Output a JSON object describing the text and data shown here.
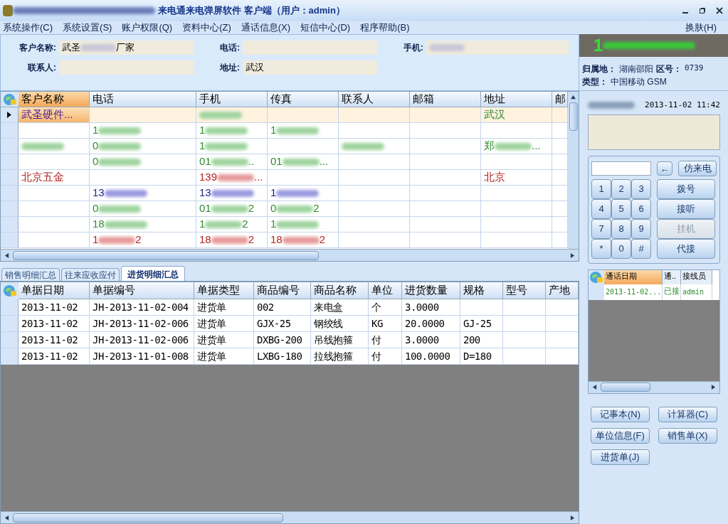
{
  "window": {
    "title": "来电通来电弹屏软件 客户端（用户：admin）"
  },
  "menu": [
    "系统操作(C)",
    "系统设置(S)",
    "账户权限(Q)",
    "资料中心(Z)",
    "通话信息(X)",
    "短信中心(D)",
    "程序帮助(B)"
  ],
  "skin_menu": "换肤(H)",
  "customer_form": [
    {
      "label": "客户名称:",
      "value": "武圣",
      "tail": "厂家",
      "blur": true
    },
    {
      "label": "电话:"
    },
    {
      "label": "手机:",
      "blur": true
    },
    {
      "label": "联系人:"
    },
    {
      "label": "地址:",
      "value": "武汉"
    }
  ],
  "customer_grid": {
    "columns": [
      "客户名称",
      "电话",
      "手机",
      "传真",
      "联系人",
      "邮箱",
      "地址",
      "邮"
    ],
    "rows": [
      {
        "selected": true,
        "color": "#4b1a8a",
        "cells": [
          {
            "text": "武圣硬件..."
          },
          null,
          {
            "blur": true
          },
          null,
          null,
          null,
          {
            "text": "武汉",
            "color": "#2e8b2e"
          },
          null
        ]
      },
      {
        "selected": false,
        "color": "#2e8b2e",
        "cells": [
          null,
          {
            "text": "1",
            "blur": true
          },
          {
            "text": "1",
            "blur": true
          },
          {
            "text": "1",
            "blur": true
          },
          null,
          null,
          null,
          null
        ]
      },
      {
        "selected": false,
        "color": "#2e8b2e",
        "cells": [
          {
            "blur": true
          },
          {
            "text": "0",
            "blur": true
          },
          {
            "text": "1",
            "blur": true
          },
          null,
          {
            "blur": true
          },
          null,
          {
            "text": "郑",
            "blur": true,
            "tail": "..."
          },
          null
        ]
      },
      {
        "selected": false,
        "color": "#2e8b2e",
        "cells": [
          null,
          {
            "text": "0",
            "blur": true
          },
          {
            "text": "01",
            "blur": true,
            "tail": ".."
          },
          {
            "text": "01",
            "blur": true,
            "tail": "..."
          },
          null,
          null,
          null,
          null
        ]
      },
      {
        "selected": false,
        "color": "#b22222",
        "cells": [
          {
            "text": "北京五金"
          },
          null,
          {
            "text": "139",
            "blur": true,
            "tail": "..."
          },
          null,
          null,
          null,
          {
            "text": "北京"
          },
          null
        ]
      },
      {
        "selected": false,
        "color": "#22228b",
        "cells": [
          null,
          {
            "text": "13",
            "blur": true
          },
          {
            "text": "13",
            "blur": true
          },
          {
            "text": "1",
            "blur": true
          },
          null,
          null,
          null,
          null
        ]
      },
      {
        "selected": false,
        "color": "#2e8b2e",
        "cells": [
          null,
          {
            "text": "0",
            "blur": true
          },
          {
            "text": "01",
            "blur": true,
            "tail": "2"
          },
          {
            "text": "0",
            "blur": true,
            "tail": "2"
          },
          null,
          null,
          null,
          null
        ]
      },
      {
        "selected": false,
        "color": "#2e8b2e",
        "cells": [
          null,
          {
            "text": "18",
            "blur": true
          },
          {
            "text": "1",
            "blur": true,
            "tail": "2"
          },
          {
            "text": "1",
            "blur": true
          },
          null,
          null,
          null,
          null
        ]
      },
      {
        "selected": false,
        "color": "#b22222",
        "cells": [
          null,
          {
            "text": "1",
            "blur": true,
            "tail": "2"
          },
          {
            "text": "18",
            "blur": true,
            "tail": "2"
          },
          {
            "text": "18",
            "blur": true,
            "tail": "2"
          },
          null,
          null,
          null,
          null
        ]
      }
    ]
  },
  "detail_tabs": [
    {
      "label": "销售明细汇总",
      "selected": false
    },
    {
      "label": "往来应收应付",
      "selected": false
    },
    {
      "label": "进货明细汇总",
      "selected": true
    }
  ],
  "detail_grid": {
    "columns": [
      "单据日期",
      "单据编号",
      "单据类型",
      "商品编号",
      "商品名称",
      "单位",
      "进货数量",
      "规格",
      "型号",
      "产地"
    ],
    "rows": [
      [
        "2013-11-02",
        "JH-2013-11-02-004",
        "进货单",
        "002",
        "来电盒",
        "个",
        "3.0000",
        null,
        null,
        null
      ],
      [
        "2013-11-02",
        "JH-2013-11-02-006",
        "进货单",
        "GJX-25",
        "钢绞线",
        "KG",
        "20.0000",
        "GJ-25",
        null,
        null
      ],
      [
        "2013-11-02",
        "JH-2013-11-02-006",
        "进货单",
        "DXBG-200",
        "吊线抱箍",
        "付",
        "3.0000",
        "200",
        null,
        null
      ],
      [
        "2013-11-02",
        "JH-2013-11-01-008",
        "进货单",
        "LXBG-180",
        "拉线抱箍",
        "付",
        "100.0000",
        "D=180",
        null,
        null
      ]
    ]
  },
  "caller": {
    "number": "1",
    "location_label": "归属地：",
    "location": "湖南邵阳",
    "area_label": "区号：",
    "area": "0739",
    "type_label": "类型：",
    "type": "中国移动 GSM",
    "time": "2013-11-02 11:42"
  },
  "keypad": {
    "keys": [
      "1",
      "2",
      "3",
      "4",
      "5",
      "6",
      "7",
      "8",
      "9",
      "*",
      "0",
      "#"
    ],
    "backspace": "←",
    "simulate": "仿来电",
    "actions": [
      {
        "label": "拨号",
        "disabled": false
      },
      {
        "label": "接听",
        "disabled": false
      },
      {
        "label": "挂机",
        "disabled": true
      },
      {
        "label": "代接",
        "disabled": false
      }
    ]
  },
  "call_log": {
    "columns": [
      "通话日期",
      "通..",
      "接线员"
    ],
    "rows": [
      [
        "2013-11-02...",
        "已接",
        "admin"
      ]
    ]
  },
  "tools": [
    "记事本(N)",
    "计算器(C)",
    "单位信息(F)",
    "销售单(X)",
    "进货单(J)"
  ]
}
